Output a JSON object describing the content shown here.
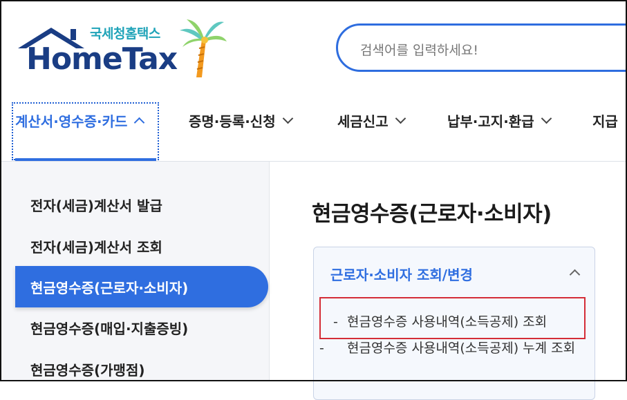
{
  "brand": {
    "korean_name": "국세청홈택스",
    "name": "HomeTax"
  },
  "search": {
    "placeholder": "검색어를 입력하세요!"
  },
  "nav": {
    "items": [
      {
        "label": "계산서·영수증·카드",
        "active": true
      },
      {
        "label": "증명·등록·신청",
        "active": false
      },
      {
        "label": "세금신고",
        "active": false
      },
      {
        "label": "납부·고지·환급",
        "active": false
      },
      {
        "label": "지급",
        "active": false
      }
    ]
  },
  "sidebar": {
    "items": [
      {
        "label": "전자(세금)계산서 발급"
      },
      {
        "label": "전자(세금)계산서 조회"
      },
      {
        "label": "현금영수증(근로자·소비자)",
        "active": true
      },
      {
        "label": "현금영수증(매입·지출증빙)"
      },
      {
        "label": "현금영수증(가맹점)"
      }
    ]
  },
  "main": {
    "title": "현금영수증(근로자·소비자)",
    "section": {
      "title": "근로자·소비자 조회/변경",
      "links": [
        {
          "label": "현금영수증 사용내역(소득공제) 조회",
          "highlighted": true
        },
        {
          "label": "현금영수증 사용내역(소득공제) 누계 조회"
        }
      ]
    }
  },
  "colors": {
    "accent": "#2f6ee0",
    "brand_navy": "#1a3d84",
    "brand_teal": "#1fa3b8",
    "highlight": "#d42c36"
  }
}
